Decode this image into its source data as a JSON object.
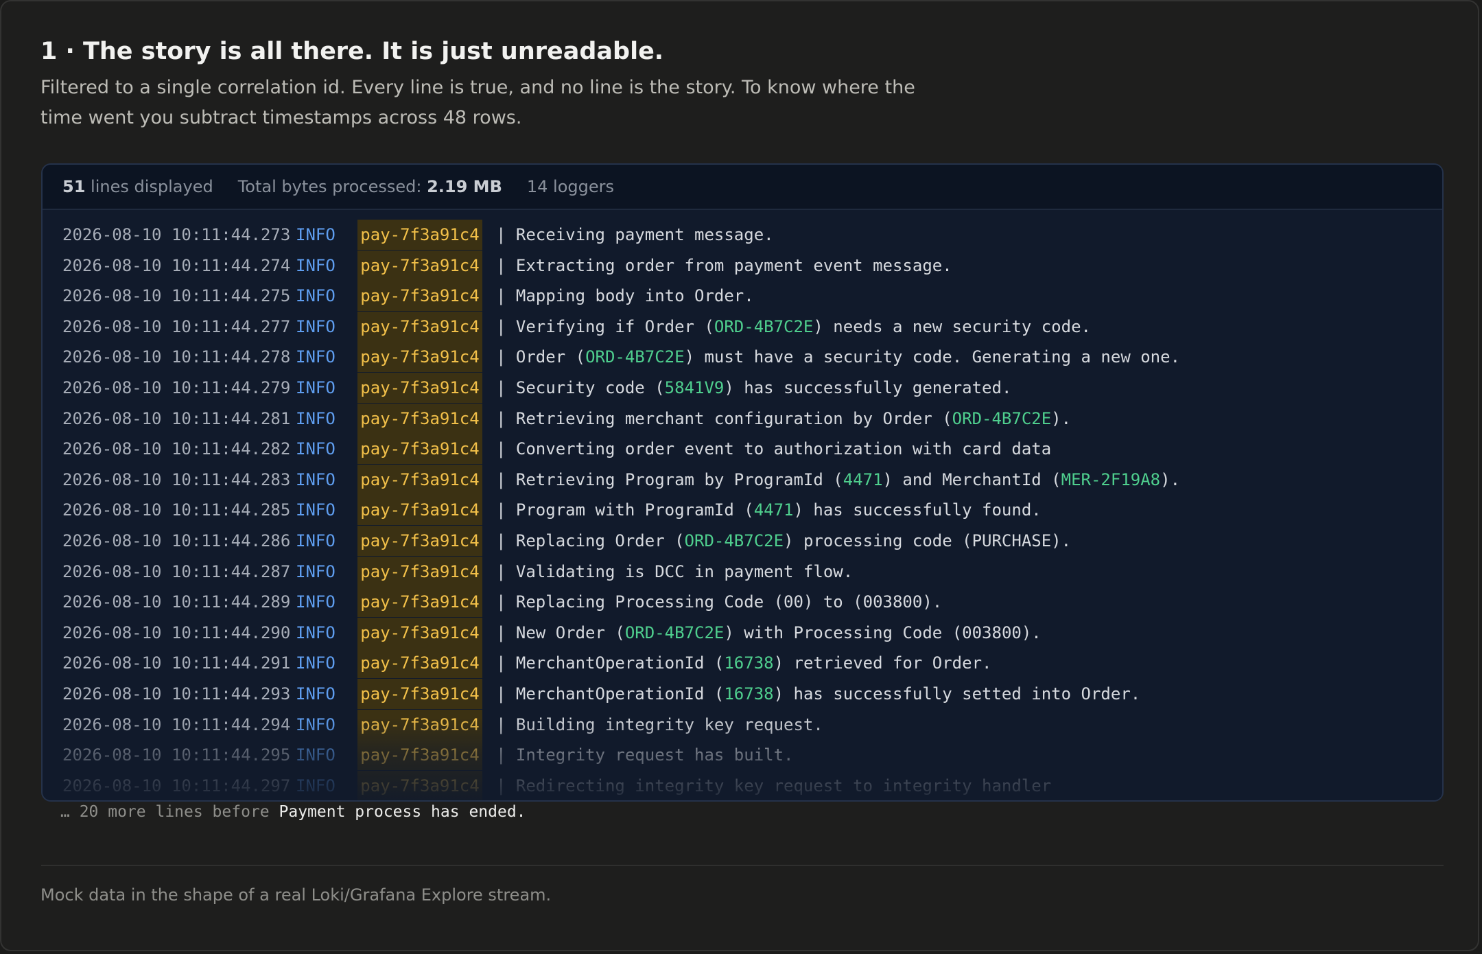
{
  "header": {
    "title": "1 · The story is all there. It is just unreadable.",
    "subtitle": "Filtered to a single correlation id. Every line is true, and no line is the story. To know where the time went you subtract timestamps across 48 rows."
  },
  "stats": {
    "lines_count": "51",
    "lines_label": "lines displayed",
    "bytes_label": "Total bytes processed:",
    "bytes_value": "2.19 MB",
    "loggers": "14 loggers"
  },
  "log": {
    "separator": "|",
    "rows": [
      {
        "ts": "2026-08-10 10:11:44.273",
        "level": "INFO",
        "cid": "pay-7f3a91c4",
        "msg": [
          {
            "t": "Receiving payment message."
          }
        ]
      },
      {
        "ts": "2026-08-10 10:11:44.274",
        "level": "INFO",
        "cid": "pay-7f3a91c4",
        "msg": [
          {
            "t": "Extracting order from payment event message."
          }
        ]
      },
      {
        "ts": "2026-08-10 10:11:44.275",
        "level": "INFO",
        "cid": "pay-7f3a91c4",
        "msg": [
          {
            "t": "Mapping body into Order."
          }
        ]
      },
      {
        "ts": "2026-08-10 10:11:44.277",
        "level": "INFO",
        "cid": "pay-7f3a91c4",
        "msg": [
          {
            "t": "Verifying if Order ("
          },
          {
            "t": "ORD-4B7C2E",
            "hl": true
          },
          {
            "t": ") needs a new security code."
          }
        ]
      },
      {
        "ts": "2026-08-10 10:11:44.278",
        "level": "INFO",
        "cid": "pay-7f3a91c4",
        "msg": [
          {
            "t": "Order ("
          },
          {
            "t": "ORD-4B7C2E",
            "hl": true
          },
          {
            "t": ") must have a security code. Generating a new one."
          }
        ]
      },
      {
        "ts": "2026-08-10 10:11:44.279",
        "level": "INFO",
        "cid": "pay-7f3a91c4",
        "msg": [
          {
            "t": "Security code ("
          },
          {
            "t": "5841V9",
            "hl": true
          },
          {
            "t": ") has successfully generated."
          }
        ]
      },
      {
        "ts": "2026-08-10 10:11:44.281",
        "level": "INFO",
        "cid": "pay-7f3a91c4",
        "msg": [
          {
            "t": "Retrieving merchant configuration by Order ("
          },
          {
            "t": "ORD-4B7C2E",
            "hl": true
          },
          {
            "t": ")."
          }
        ]
      },
      {
        "ts": "2026-08-10 10:11:44.282",
        "level": "INFO",
        "cid": "pay-7f3a91c4",
        "msg": [
          {
            "t": "Converting order event to authorization with card data"
          }
        ]
      },
      {
        "ts": "2026-08-10 10:11:44.283",
        "level": "INFO",
        "cid": "pay-7f3a91c4",
        "msg": [
          {
            "t": "Retrieving Program by ProgramId ("
          },
          {
            "t": "4471",
            "hl": true
          },
          {
            "t": ") and MerchantId ("
          },
          {
            "t": "MER-2F19A8",
            "hl": true
          },
          {
            "t": ")."
          }
        ]
      },
      {
        "ts": "2026-08-10 10:11:44.285",
        "level": "INFO",
        "cid": "pay-7f3a91c4",
        "msg": [
          {
            "t": "Program with ProgramId ("
          },
          {
            "t": "4471",
            "hl": true
          },
          {
            "t": ") has successfully found."
          }
        ]
      },
      {
        "ts": "2026-08-10 10:11:44.286",
        "level": "INFO",
        "cid": "pay-7f3a91c4",
        "msg": [
          {
            "t": "Replacing Order ("
          },
          {
            "t": "ORD-4B7C2E",
            "hl": true
          },
          {
            "t": ") processing code (PURCHASE)."
          }
        ]
      },
      {
        "ts": "2026-08-10 10:11:44.287",
        "level": "INFO",
        "cid": "pay-7f3a91c4",
        "msg": [
          {
            "t": "Validating is DCC in payment flow."
          }
        ]
      },
      {
        "ts": "2026-08-10 10:11:44.289",
        "level": "INFO",
        "cid": "pay-7f3a91c4",
        "msg": [
          {
            "t": "Replacing Processing Code (00) to (003800)."
          }
        ]
      },
      {
        "ts": "2026-08-10 10:11:44.290",
        "level": "INFO",
        "cid": "pay-7f3a91c4",
        "msg": [
          {
            "t": "New Order ("
          },
          {
            "t": "ORD-4B7C2E",
            "hl": true
          },
          {
            "t": ") with Processing Code (003800)."
          }
        ]
      },
      {
        "ts": "2026-08-10 10:11:44.291",
        "level": "INFO",
        "cid": "pay-7f3a91c4",
        "msg": [
          {
            "t": "MerchantOperationId ("
          },
          {
            "t": "16738",
            "hl": true
          },
          {
            "t": ") retrieved for Order."
          }
        ]
      },
      {
        "ts": "2026-08-10 10:11:44.293",
        "level": "INFO",
        "cid": "pay-7f3a91c4",
        "msg": [
          {
            "t": "MerchantOperationId ("
          },
          {
            "t": "16738",
            "hl": true
          },
          {
            "t": ") has successfully setted into Order."
          }
        ]
      },
      {
        "ts": "2026-08-10 10:11:44.294",
        "level": "INFO",
        "cid": "pay-7f3a91c4",
        "msg": [
          {
            "t": "Building integrity key request."
          }
        ]
      },
      {
        "ts": "2026-08-10 10:11:44.295",
        "level": "INFO",
        "cid": "pay-7f3a91c4",
        "msg": [
          {
            "t": "Integrity request has built."
          }
        ]
      },
      {
        "ts": "2026-08-10 10:11:44.297",
        "level": "INFO",
        "cid": "pay-7f3a91c4",
        "msg": [
          {
            "t": "Redirecting integrity key request to integrity handler"
          }
        ]
      }
    ]
  },
  "more": {
    "prefix": "… 20 more lines before",
    "end_text": "Payment process has ended."
  },
  "footer": {
    "text": "Mock data in the shape of a real Loki/Grafana Explore stream."
  },
  "colors": {
    "background": "#1e1e1d",
    "panel": "#111a2b",
    "level": "#5f9ef0",
    "correlation_id": "#f2c049",
    "correlation_bg": "#3b3113",
    "highlight": "#4fcf8e"
  }
}
